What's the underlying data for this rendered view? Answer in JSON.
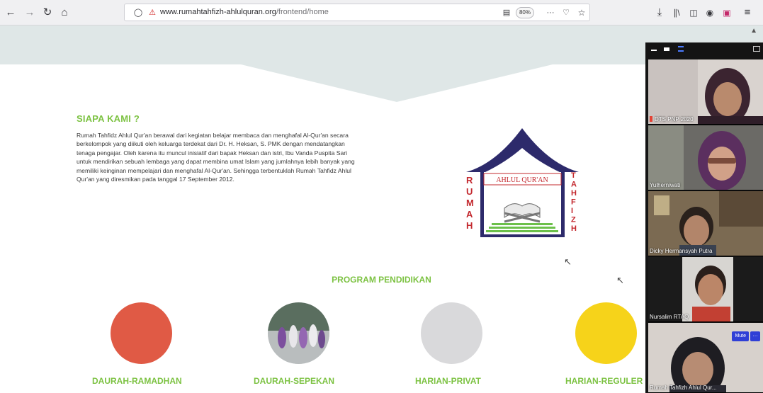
{
  "browser": {
    "url_host": "www.rumahtahfizh-ahlulquran.org",
    "url_path": "/frontend/home",
    "zoom": "80%"
  },
  "about": {
    "title": "SIAPA KAMI ?",
    "body": "Rumah Tahfidz Ahlul Qur'an berawal dari kegiatan belajar membaca dan menghafal Al-Qur'an secara berkelompok yang diikuti oleh keluarga terdekat dari Dr. H. Heksan, S. PMK dengan mendatangkan tenaga pengajar. Oleh karena itu muncul inisiatif dari bapak Heksan dan istri, Ibu Vanda Puspita Sari untuk mendirikan sebuah lembaga yang dapat membina umat Islam yang jumlahnya lebih banyak yang memiliki keinginan mempelajari dan menghafal Al-Qur'an. Sehingga terbentuklah Rumah Tahfidz Ahlul Qur'an yang diresmikan pada tanggal 17 September 2012."
  },
  "logo": {
    "banner": "AHLUL QUR'AN",
    "left": [
      "R",
      "U",
      "M",
      "A",
      "H"
    ],
    "right": [
      "T",
      "A",
      "H",
      "F",
      "I",
      "Z",
      "H"
    ]
  },
  "programs": {
    "title": "PROGRAM PENDIDIKAN",
    "items": [
      {
        "label": "DAURAH-RAMADHAN",
        "color": "#e05a45"
      },
      {
        "label": "DAURAH-SEPEKAN",
        "color": "photo"
      },
      {
        "label": "HARIAN-PRIVAT",
        "color": "#d9d9db"
      },
      {
        "label": "HARIAN-REGULER",
        "color": "#f6d31a"
      }
    ]
  },
  "colors": {
    "accent_green": "#7cc242",
    "hero_band": "#dfe7e7",
    "logo_navy": "#2d2a6b",
    "logo_red": "#c3282e"
  },
  "call": {
    "participants": [
      {
        "name": "DTS PNP 2020"
      },
      {
        "name": "Yulherniwati"
      },
      {
        "name": "Dicky Hermansyah Putra"
      },
      {
        "name": "Nursalim RTAQ"
      },
      {
        "name": "Rumah Tahfizh Ahlul Qur..."
      }
    ],
    "mute_label": "Mute",
    "more_label": "···"
  }
}
